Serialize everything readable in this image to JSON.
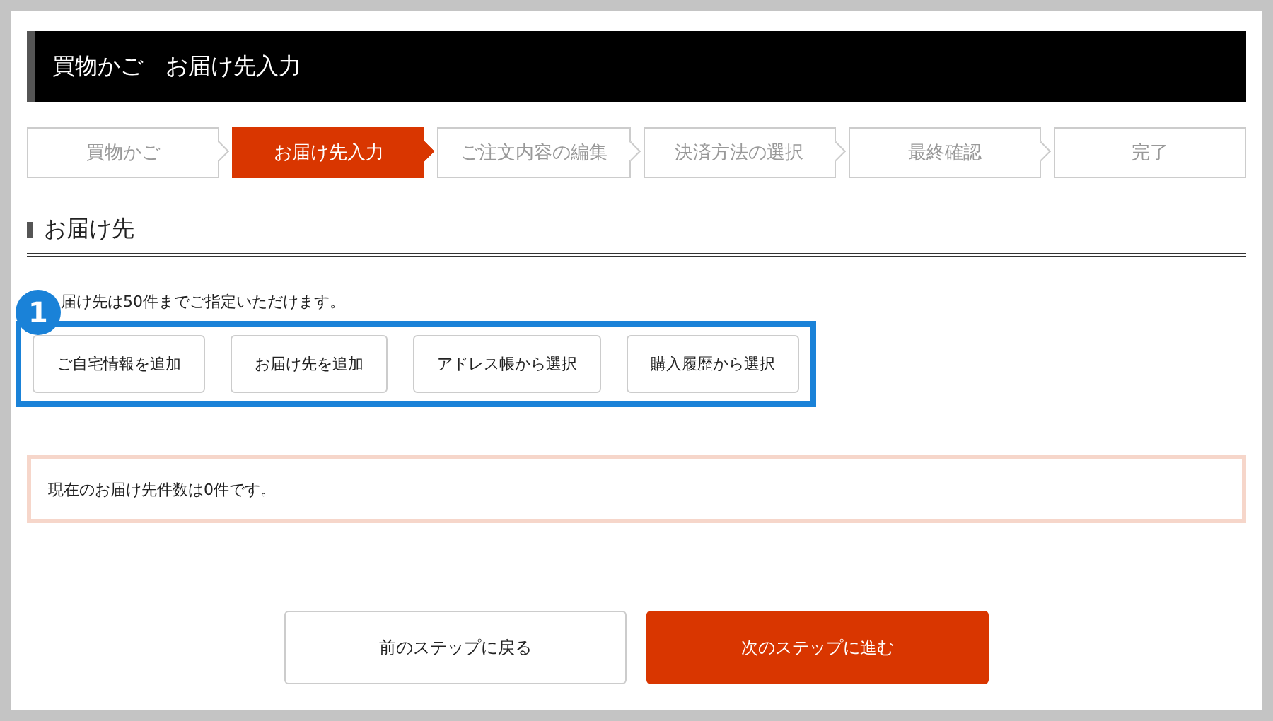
{
  "header": {
    "title": "買物かご　お届け先入力"
  },
  "steps": [
    {
      "label": "買物かご",
      "selected": false
    },
    {
      "label": "お届け先入力",
      "selected": true
    },
    {
      "label": "ご注文内容の編集",
      "selected": false
    },
    {
      "label": "決済方法の選択",
      "selected": false
    },
    {
      "label": "最終確認",
      "selected": false
    },
    {
      "label": "完了",
      "selected": false
    }
  ],
  "section": {
    "heading": "お届け先",
    "note": "届け先は50件までご指定いただけます。"
  },
  "callout": {
    "number": "1"
  },
  "actions": [
    "ご自宅情報を追加",
    "お届け先を追加",
    "アドレス帳から選択",
    "購入履歴から選択"
  ],
  "count_message": "現在のお届け先件数は0件です。",
  "nav_buttons": [
    {
      "label": "前のステップに戻る",
      "kind": "secondary"
    },
    {
      "label": "次のステップに進む",
      "kind": "primary"
    }
  ]
}
